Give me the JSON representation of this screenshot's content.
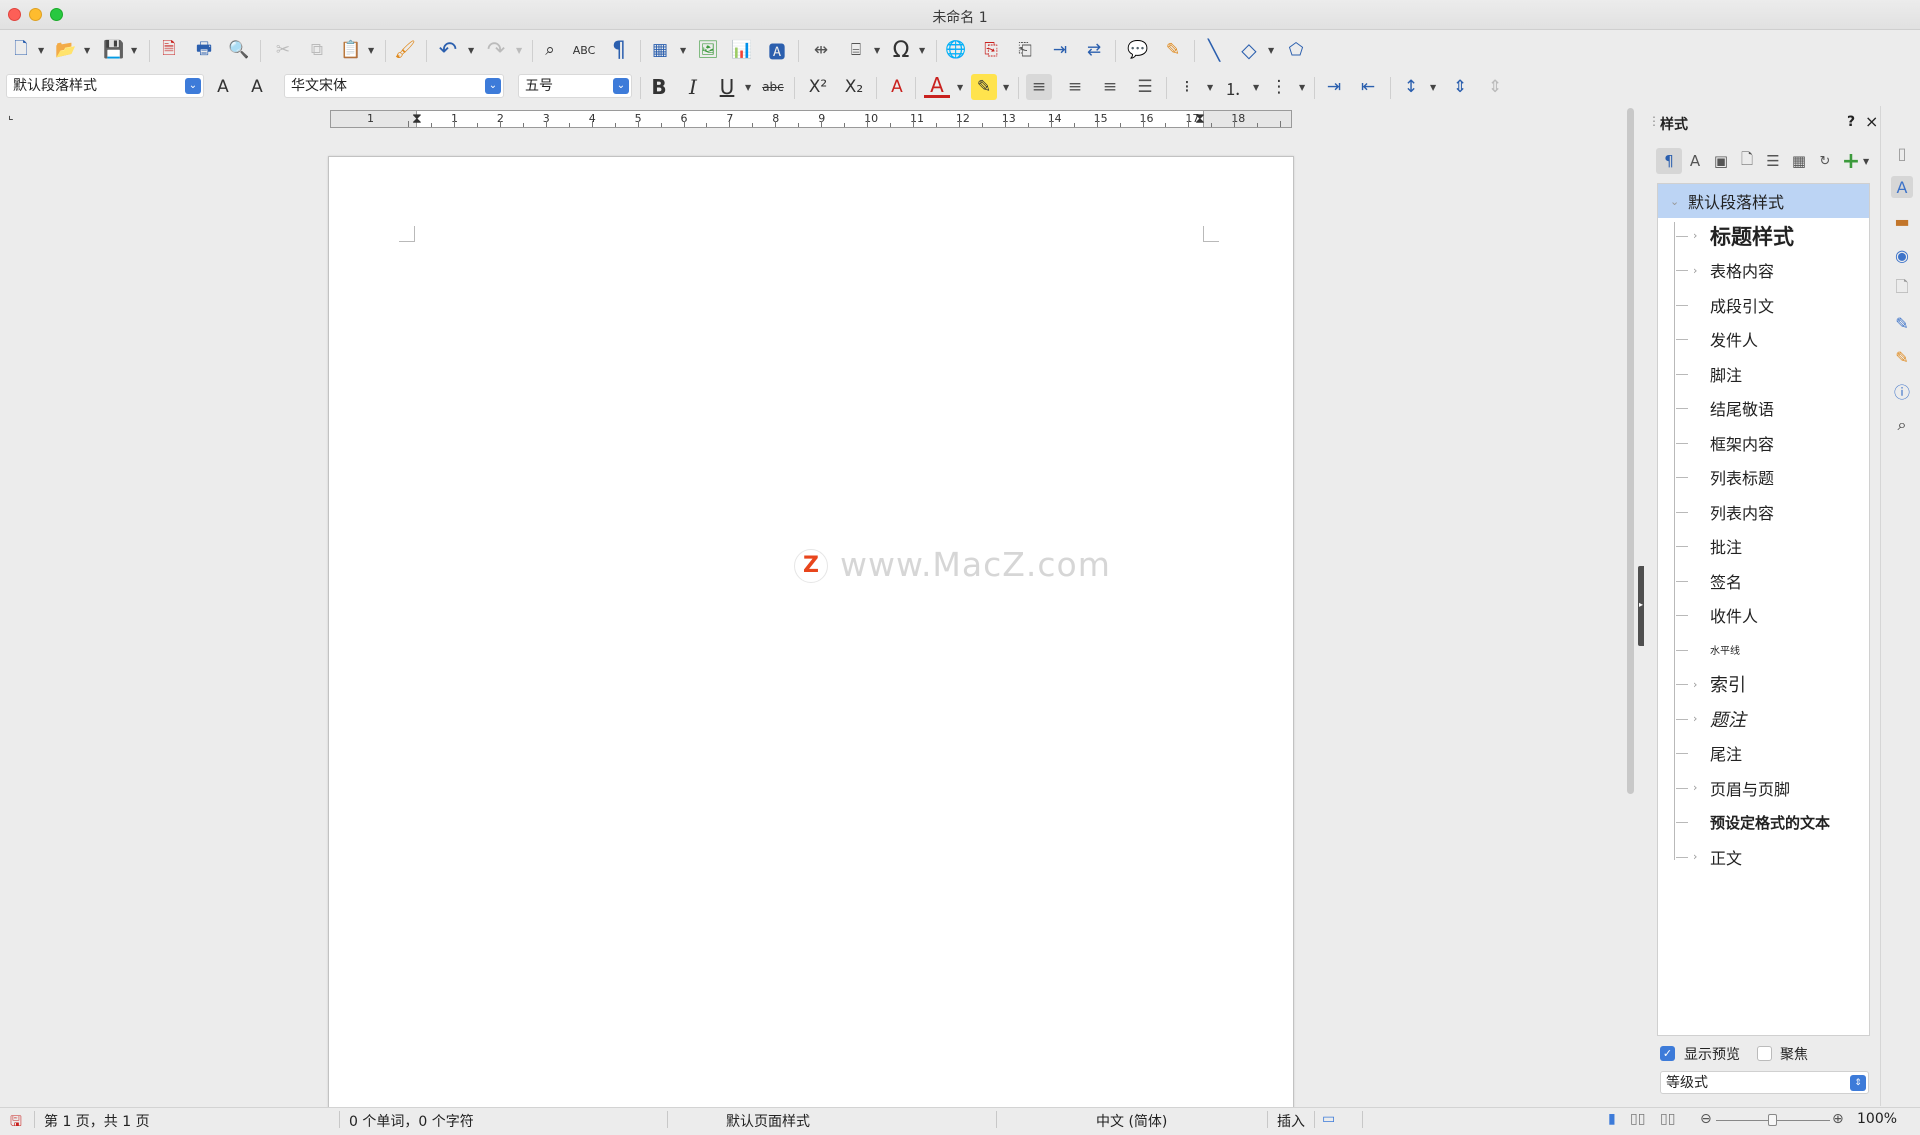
{
  "window": {
    "title": "未命名 1"
  },
  "formatting": {
    "paragraph_style": "默认段落样式",
    "font_name": "华文宋体",
    "font_size": "五号"
  },
  "ruler": {
    "numbers": [
      "1",
      "1",
      "2",
      "3",
      "4",
      "5",
      "6",
      "7",
      "8",
      "9",
      "10",
      "11",
      "12",
      "13",
      "14",
      "15",
      "16",
      "17",
      "18"
    ]
  },
  "watermark": {
    "logo": "Z",
    "text": "www.MacZ.com"
  },
  "sidebar": {
    "title": "样式",
    "help": "?",
    "close": "×",
    "menu": "≡",
    "styles": [
      {
        "label": "默认段落样式",
        "selected": true,
        "expand": false
      },
      {
        "label": "标题样式",
        "expand": true,
        "weight": "bold",
        "size": 21
      },
      {
        "label": "表格内容",
        "expand": true
      },
      {
        "label": "成段引文"
      },
      {
        "label": "发件人"
      },
      {
        "label": "脚注"
      },
      {
        "label": "结尾敬语"
      },
      {
        "label": "框架内容"
      },
      {
        "label": "列表标题"
      },
      {
        "label": "列表内容"
      },
      {
        "label": "批注"
      },
      {
        "label": "签名"
      },
      {
        "label": "收件人"
      },
      {
        "label": "水平线",
        "size": 10
      },
      {
        "label": "索引",
        "expand": true,
        "size": 18
      },
      {
        "label": "题注",
        "expand": true,
        "italic": true,
        "size": 18
      },
      {
        "label": "尾注"
      },
      {
        "label": "页眉与页脚",
        "expand": true
      },
      {
        "label": "预设定格式的文本",
        "weight": "bold",
        "size": 15
      },
      {
        "label": "正文",
        "expand": true
      }
    ],
    "show_preview_label": "显示预览",
    "show_preview_checked": true,
    "focus_label": "聚焦",
    "focus_checked": false,
    "filter": "等级式"
  },
  "statusbar": {
    "page": "第 1 页，共 1 页",
    "words": "0 个单词，0 个字符",
    "page_style": "默认页面样式",
    "language": "中文 (简体)",
    "insert_mode": "插入",
    "zoom": "100%"
  },
  "colors": {
    "accent": "#3d7bd9",
    "selection": "#bcd4f4",
    "font_color": "#c9211e",
    "highlight": "#ffe34d"
  }
}
